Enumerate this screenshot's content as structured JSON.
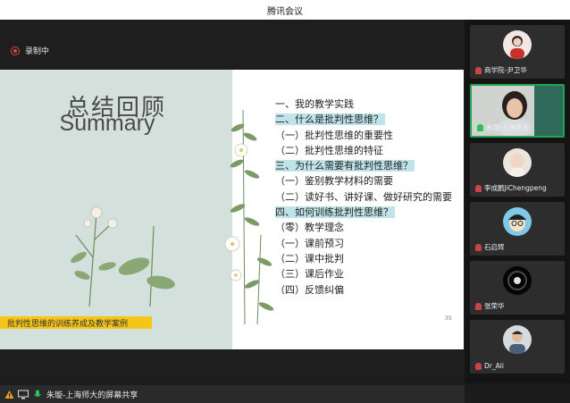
{
  "window": {
    "title": "腾讯会议"
  },
  "recording": {
    "label": "录制中"
  },
  "slide": {
    "title_cn": "总结回顾",
    "title_en": "Summary",
    "banner": "批判性思维的训练养成及教学案例",
    "page": "35",
    "outline": [
      {
        "text": "一、我的教学实践",
        "hl": false
      },
      {
        "text": "二、什么是批判性思维？",
        "hl": true
      },
      {
        "text": "（一）批判性思维的重要性",
        "hl": false
      },
      {
        "text": "（二）批判性思维的特征",
        "hl": false
      },
      {
        "text": "三、为什么需要有批判性思维？",
        "hl": true
      },
      {
        "text": "（一）鉴别教学材料的需要",
        "hl": false
      },
      {
        "text": "（二）读好书、讲好课、做好研究的需要",
        "hl": false
      },
      {
        "text": "四、如何训练批判性思维？",
        "hl": true
      },
      {
        "text": "（零）教学理念",
        "hl": false
      },
      {
        "text": "（一）课前预习",
        "hl": false
      },
      {
        "text": "（二）课中批判",
        "hl": false
      },
      {
        "text": "（三）课后作业",
        "hl": false
      },
      {
        "text": "（四）反馈纠偏",
        "hl": false
      }
    ]
  },
  "share": {
    "label": "朱璇-上海师大的屏幕共享"
  },
  "participants": [
    {
      "name": "商学院-尹卫华",
      "mic": "off",
      "icon": "avatar-woman-red"
    },
    {
      "name": "朱璇-上海师大",
      "mic": "on",
      "icon": "video-woman-speaker"
    },
    {
      "name": "李成鹏JiChengpeng",
      "mic": "off",
      "icon": "avatar-baby"
    },
    {
      "name": "石启辉",
      "mic": "off",
      "icon": "avatar-cartoon-boy"
    },
    {
      "name": "张荣华",
      "mic": "off",
      "icon": "avatar-dark-ring"
    },
    {
      "name": "Dr_Ali",
      "mic": "off",
      "icon": "avatar-man"
    }
  ]
}
